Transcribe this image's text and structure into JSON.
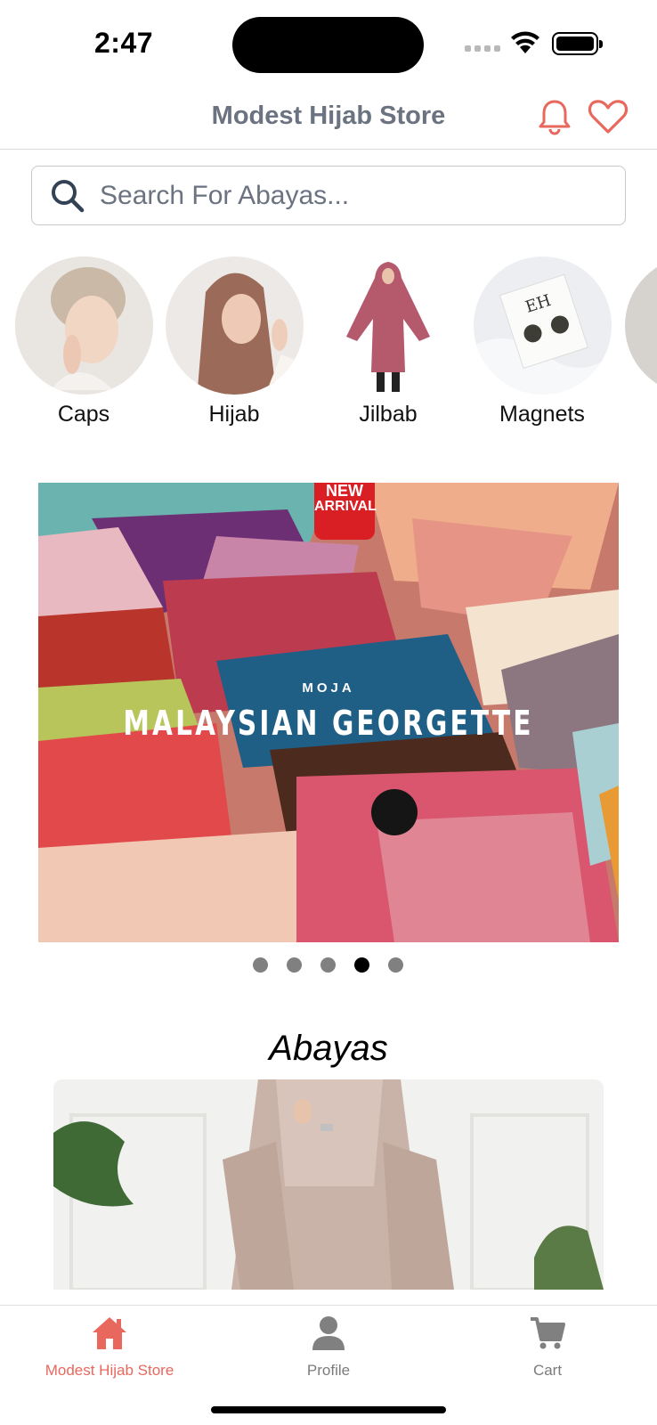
{
  "status_bar": {
    "time": "2:47"
  },
  "header": {
    "title": "Modest Hijab Store",
    "accent_color": "#e8685e"
  },
  "search": {
    "placeholder": "Search For Abayas..."
  },
  "categories": [
    {
      "label": "Caps"
    },
    {
      "label": "Hijab"
    },
    {
      "label": "Jilbab"
    },
    {
      "label": "Magnets"
    }
  ],
  "banner": {
    "badge_line1": "NEW",
    "badge_line2": "ARRIVAL",
    "brand": "MOJA",
    "headline": "MALAYSIAN GEORGETTE",
    "active_slide": 4,
    "slide_count": 5
  },
  "section": {
    "title": "Abayas"
  },
  "tabbar": {
    "items": [
      {
        "label": "Modest Hijab Store",
        "icon": "home-icon",
        "active": true
      },
      {
        "label": "Profile",
        "icon": "person-icon",
        "active": false
      },
      {
        "label": "Cart",
        "icon": "cart-icon",
        "active": false
      }
    ]
  }
}
